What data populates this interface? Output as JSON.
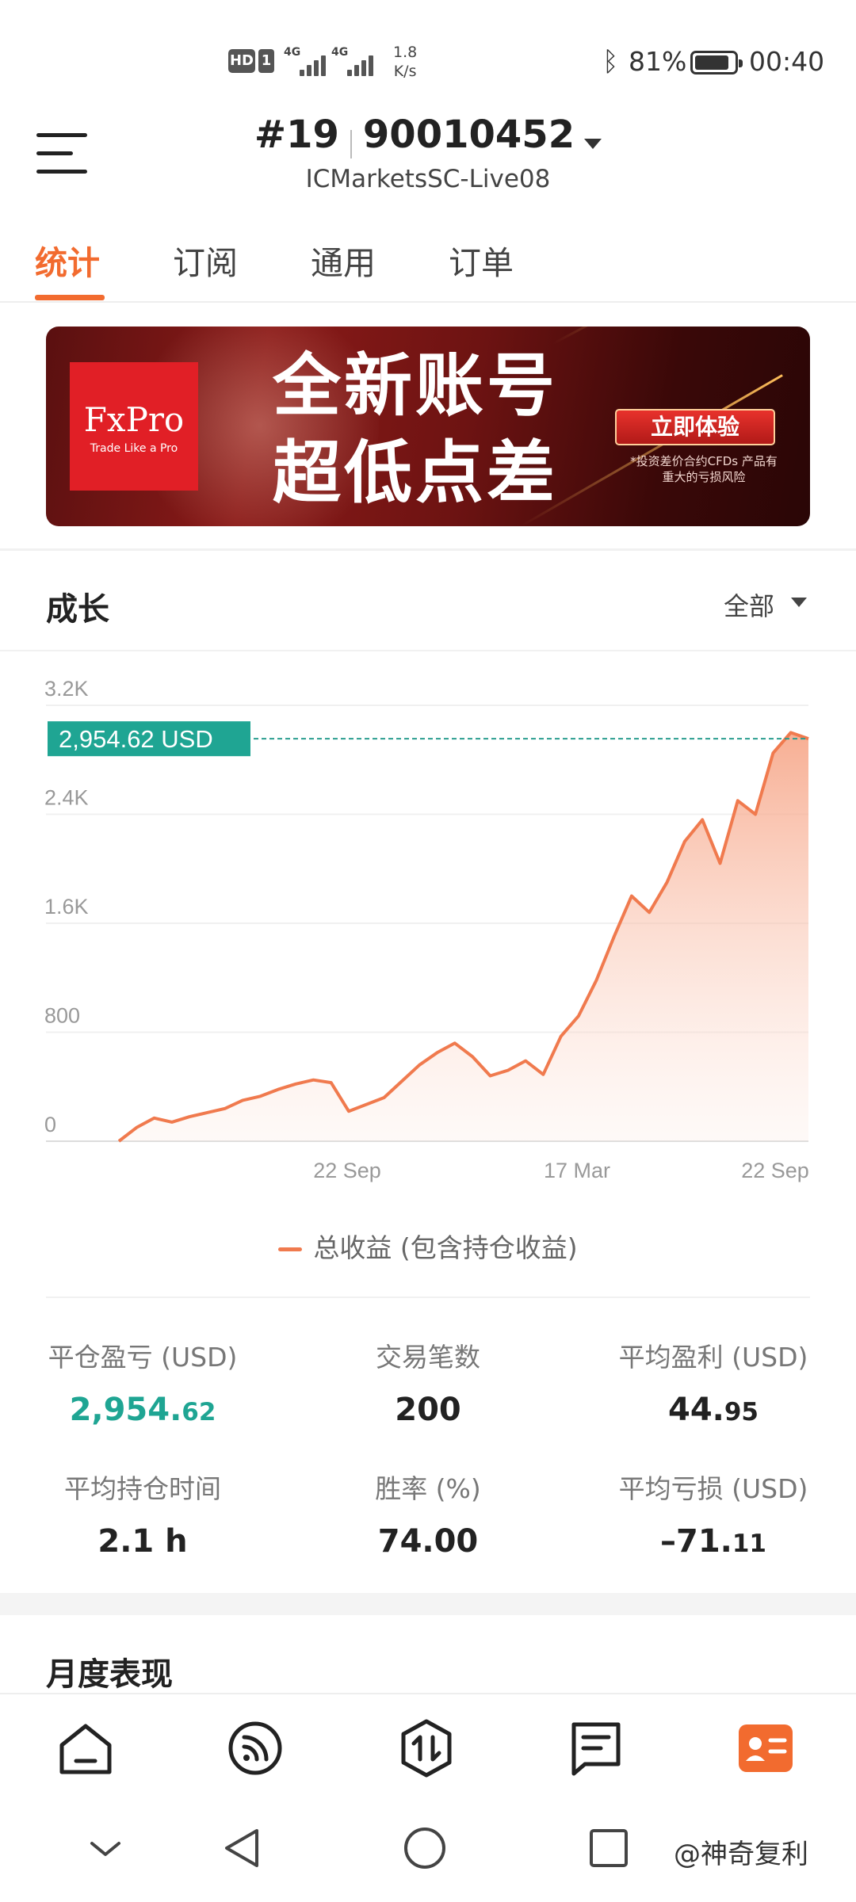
{
  "status_bar": {
    "hd": "HD",
    "sim": "1",
    "signal1": "4G",
    "signal2": "4G",
    "speed_value": "1.8",
    "speed_unit": "K/s",
    "battery": "81%",
    "time": "00:40"
  },
  "header": {
    "account_prefix": "#19",
    "account_number": "90010452",
    "server": "ICMarketsSC-Live08"
  },
  "tabs": [
    {
      "label": "统计",
      "active": true
    },
    {
      "label": "订阅",
      "active": false
    },
    {
      "label": "通用",
      "active": false
    },
    {
      "label": "订单",
      "active": false
    }
  ],
  "banner": {
    "brand": "FxPro",
    "brand_tagline": "Trade Like a Pro",
    "headline_line1": "全新账号",
    "headline_line2": "超低点差",
    "cta": "立即体验",
    "disclaimer": "*投资差价合约CFDs 产品有重大的亏损风险"
  },
  "growth": {
    "title": "成长",
    "range": "全部",
    "legend": "总收益 (包含持仓收益)",
    "current_value_label": "2,954.62 USD"
  },
  "chart_data": {
    "type": "area",
    "series": [
      {
        "name": "总收益 (包含持仓收益)",
        "color": "#f07a4e"
      }
    ],
    "ylim": [
      0,
      3200
    ],
    "yticks": [
      "0",
      "800",
      "1.6K",
      "2.4K",
      "3.2K"
    ],
    "xticks": [
      "22 Sep",
      "17 Mar",
      "22 Sep"
    ],
    "current_value": 2954.62,
    "x": [
      0,
      5,
      10,
      15,
      20,
      23,
      25,
      28,
      30,
      33,
      35,
      40,
      45,
      50,
      55,
      58,
      60,
      62,
      65,
      70,
      73,
      75,
      78,
      80,
      82,
      85,
      88,
      90,
      93,
      95,
      97,
      99,
      100
    ],
    "values": [
      0,
      100,
      170,
      140,
      180,
      210,
      240,
      300,
      330,
      380,
      420,
      450,
      430,
      220,
      270,
      320,
      440,
      560,
      650,
      720,
      620,
      480,
      520,
      590,
      490,
      770,
      920,
      1180,
      1500,
      1800,
      1680,
      1900,
      2200,
      2360,
      2040,
      2500,
      2400,
      2850,
      3000,
      2954.62
    ]
  },
  "stats": [
    {
      "label": "平仓盈亏 (USD)",
      "int": "2,954.",
      "dec": "62",
      "highlight": true
    },
    {
      "label": "交易笔数",
      "int": "200",
      "dec": "",
      "highlight": false
    },
    {
      "label": "平均盈利 (USD)",
      "int": "44.",
      "dec": "95",
      "highlight": false
    },
    {
      "label": "平均持仓时间",
      "int": "2.1 h",
      "dec": "",
      "highlight": false
    },
    {
      "label": "胜率 (%)",
      "int": "74.00",
      "dec": "",
      "highlight": false
    },
    {
      "label": "平均亏损 (USD)",
      "int": "–71.",
      "dec": "11",
      "highlight": false
    }
  ],
  "monthly": {
    "title": "月度表现"
  },
  "bottom_nav": [
    {
      "name": "home-icon"
    },
    {
      "name": "feed-icon"
    },
    {
      "name": "trade-icon"
    },
    {
      "name": "news-icon"
    },
    {
      "name": "profile-icon"
    }
  ],
  "watermark": "@神奇复利"
}
